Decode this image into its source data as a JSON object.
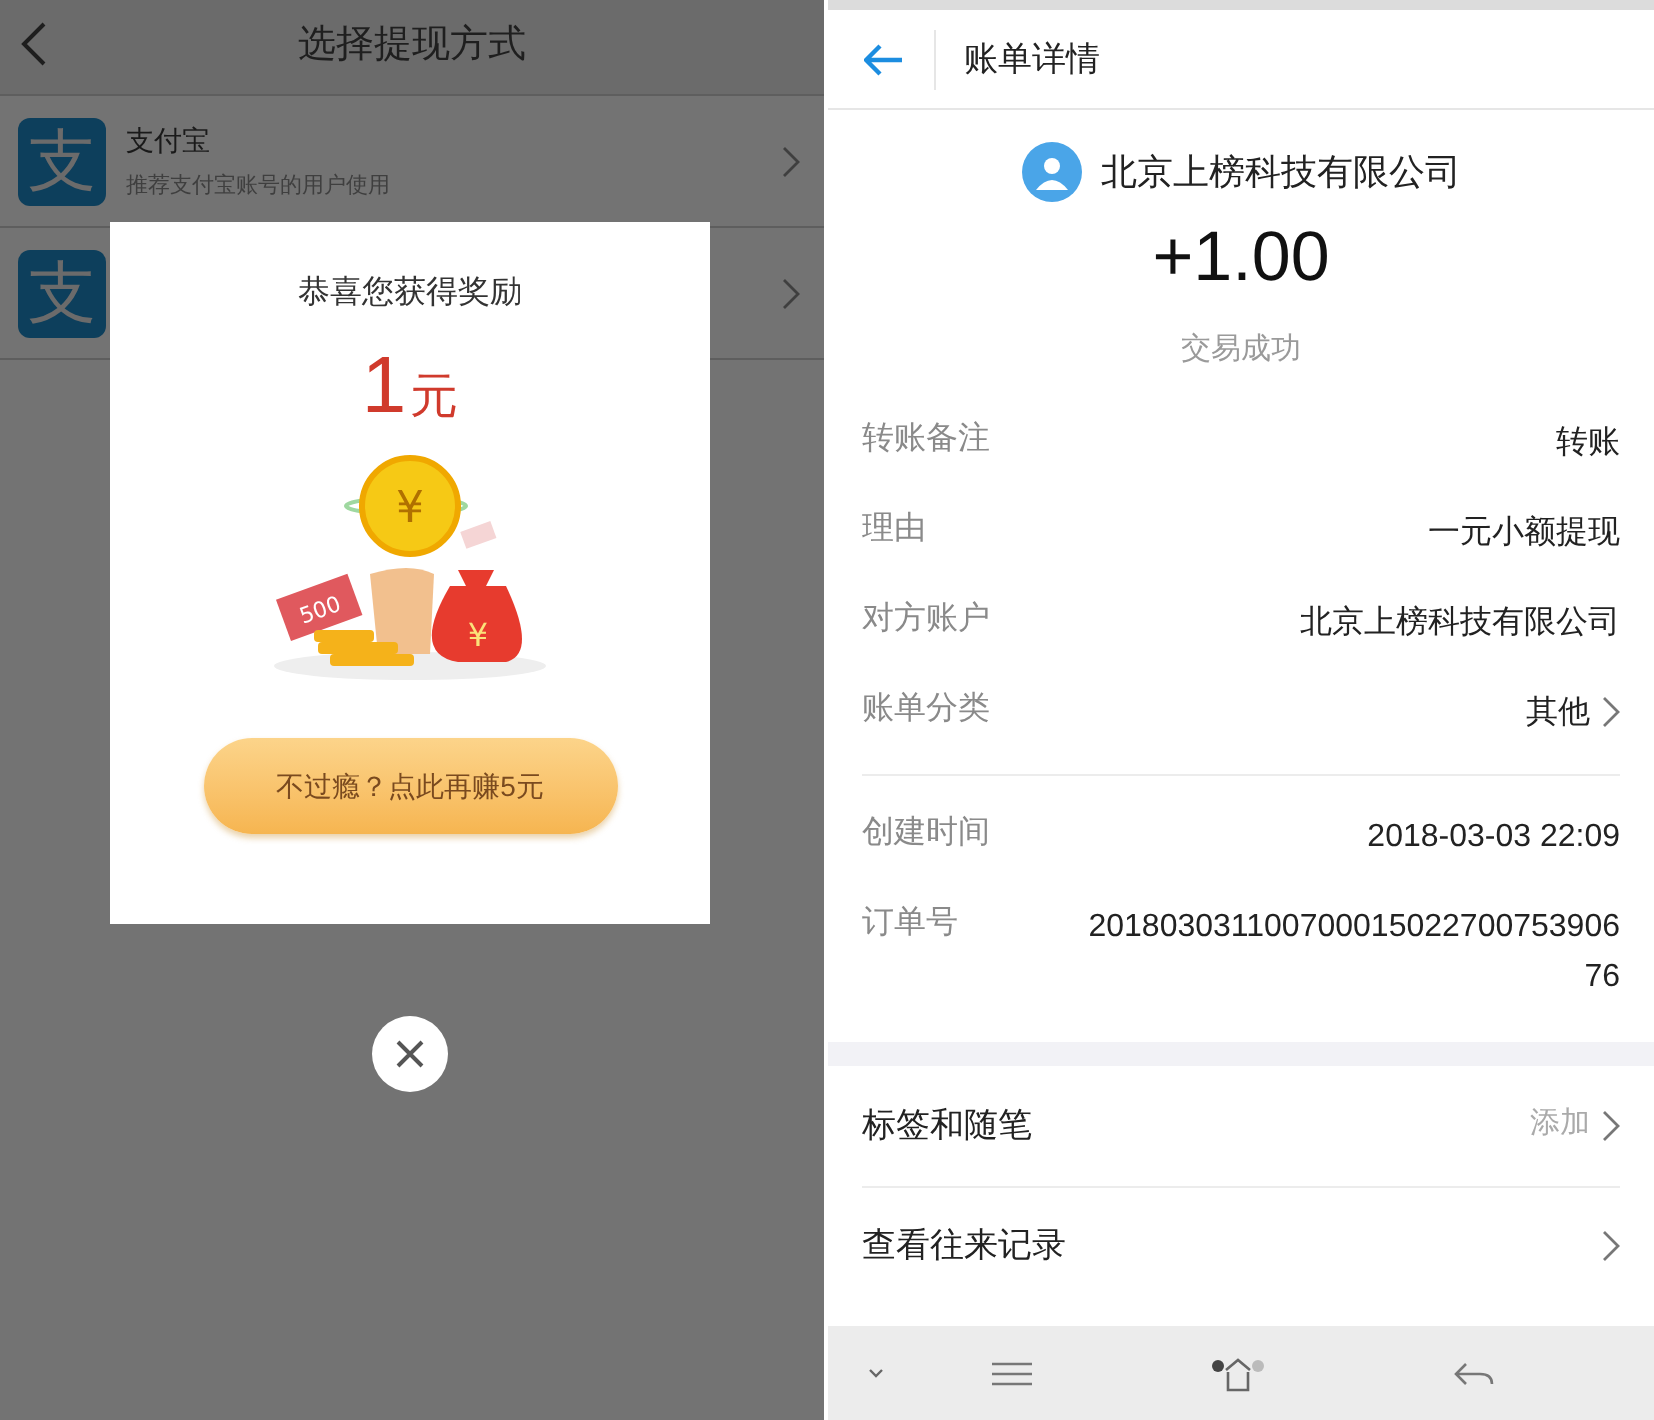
{
  "left_screen": {
    "title": "选择提现方式",
    "methods": [
      {
        "logo": "支",
        "name": "支付宝",
        "description": "推荐支付宝账号的用户使用"
      },
      {
        "logo": "支"
      }
    ],
    "dialog": {
      "title": "恭喜您获得奖励",
      "amount": "1",
      "unit": "元",
      "banknote_label": "500",
      "coin_symbol": "¥",
      "bag_symbol": "¥",
      "button": "不过瘾？点此再赚5元"
    }
  },
  "right_screen": {
    "title": "账单详情",
    "payee": "北京上榜科技有限公司",
    "amount": "+1.00",
    "status": "交易成功",
    "detail_groups": [
      [
        {
          "label": "转账备注",
          "value": "转账",
          "chevron": false
        },
        {
          "label": "理由",
          "value": "一元小额提现",
          "chevron": false
        },
        {
          "label": "对方账户",
          "value": "北京上榜科技有限公司",
          "chevron": false
        },
        {
          "label": "账单分类",
          "value": "其他",
          "chevron": true
        }
      ],
      [
        {
          "label": "创建时间",
          "value": "2018-03-03 22:09",
          "chevron": false
        },
        {
          "label": "订单号",
          "value": "20180303110070001502270075390676",
          "chevron": false
        }
      ]
    ],
    "actions": [
      {
        "label": "标签和随笔",
        "value": "添加",
        "chevron": true
      },
      {
        "label": "查看往来记录",
        "chevron": true
      }
    ]
  }
}
